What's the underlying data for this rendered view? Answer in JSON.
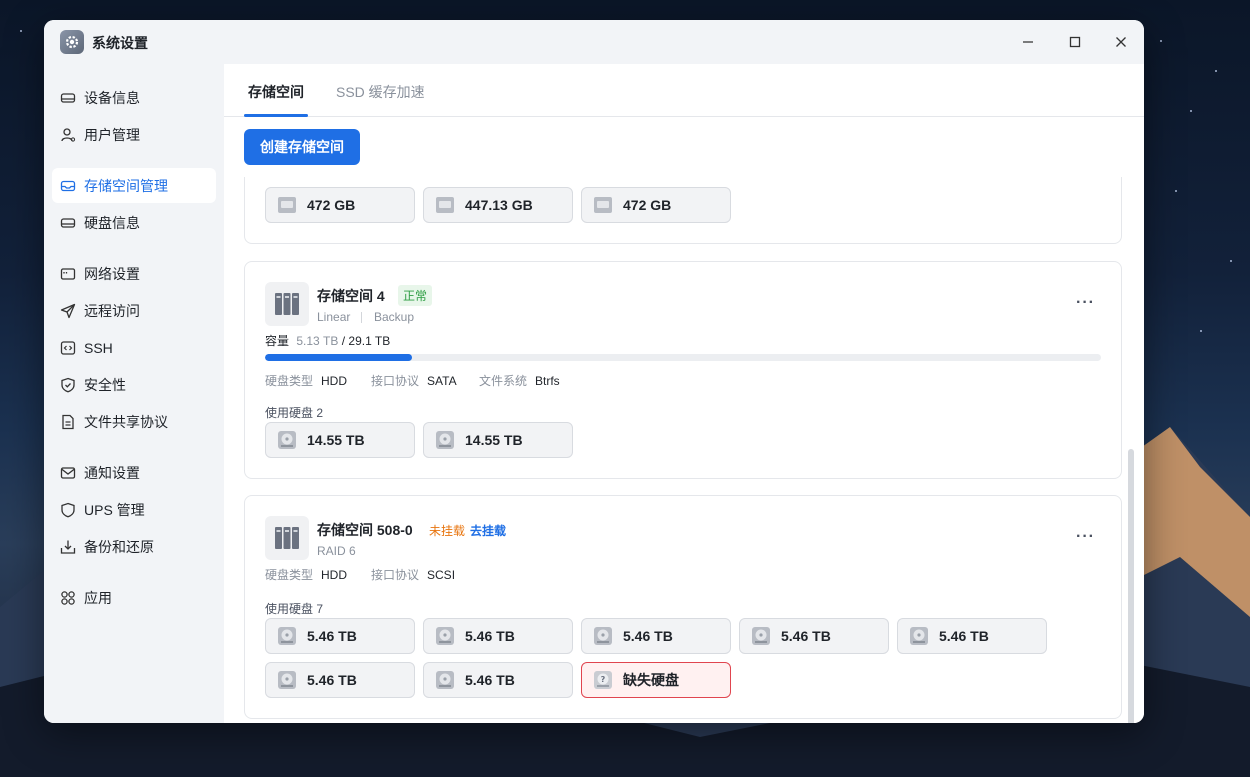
{
  "window": {
    "title": "系统设置"
  },
  "sidebar": {
    "groups": [
      [
        {
          "label": "设备信息",
          "icon": "device-icon"
        },
        {
          "label": "用户管理",
          "icon": "user-icon"
        }
      ],
      [
        {
          "label": "存储空间管理",
          "icon": "storage-icon",
          "active": true
        },
        {
          "label": "硬盘信息",
          "icon": "disk-icon"
        }
      ],
      [
        {
          "label": "网络设置",
          "icon": "network-icon"
        },
        {
          "label": "远程访问",
          "icon": "send-icon"
        },
        {
          "label": "SSH",
          "icon": "code-icon"
        },
        {
          "label": "安全性",
          "icon": "shield-icon"
        },
        {
          "label": "文件共享协议",
          "icon": "file-icon"
        }
      ],
      [
        {
          "label": "通知设置",
          "icon": "mail-icon"
        },
        {
          "label": "UPS 管理",
          "icon": "ups-shield-icon"
        },
        {
          "label": "备份和还原",
          "icon": "backup-icon"
        }
      ],
      [
        {
          "label": "应用",
          "icon": "apps-icon"
        }
      ]
    ]
  },
  "tabs": [
    {
      "label": "存储空间"
    },
    {
      "label": "SSD 缓存加速"
    }
  ],
  "toolbar": {
    "create_label": "创建存储空间"
  },
  "pool_partial": {
    "disks": [
      "472 GB",
      "447.13 GB",
      "472 GB"
    ]
  },
  "pool4": {
    "name": "存储空间 4",
    "status": "正常",
    "type": "Linear",
    "usage": "Backup",
    "capacity_label": "容量",
    "used": "5.13 TB",
    "total": "/ 29.1 TB",
    "used_fraction": 0.176,
    "disk_type_label": "硬盘类型",
    "disk_type": "HDD",
    "iface_label": "接口协议",
    "iface": "SATA",
    "fs_label": "文件系统",
    "fs": "Btrfs",
    "used_disks_label": "使用硬盘 2",
    "disks": [
      "14.55 TB",
      "14.55 TB"
    ]
  },
  "pool508": {
    "name": "存储空间 508-0",
    "status": "未挂载",
    "action": "去挂载",
    "type": "RAID 6",
    "disk_type_label": "硬盘类型",
    "disk_type": "HDD",
    "iface_label": "接口协议",
    "iface": "SCSI",
    "used_disks_label": "使用硬盘 7",
    "disks": [
      "5.46 TB",
      "5.46 TB",
      "5.46 TB",
      "5.46 TB",
      "5.46 TB",
      "5.46 TB",
      "5.46 TB"
    ],
    "missing_label": "缺失硬盘"
  },
  "more_glyph": "···",
  "colors": {
    "accent": "#1f6fe5",
    "ok": "#2f9e44",
    "warn": "#e8750f",
    "danger": "#e0454f"
  }
}
